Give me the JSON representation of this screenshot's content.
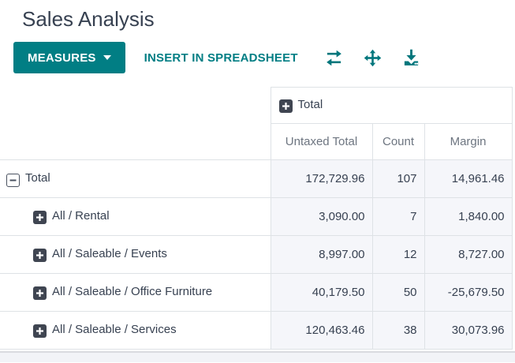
{
  "page": {
    "title": "Sales Analysis"
  },
  "toolbar": {
    "measures_label": "MEASURES",
    "insert_label": "INSERT IN SPREADSHEET",
    "icons": {
      "flip": "flip-axis-icon",
      "expand": "expand-all-icon",
      "download": "download-icon"
    }
  },
  "pivot": {
    "col_group_header": "Total",
    "measure_headers": [
      "Untaxed Total",
      "Count",
      "Margin"
    ],
    "rows": [
      {
        "label": "Total",
        "expanded": true,
        "level": 0,
        "values": [
          "172,729.96",
          "107",
          "14,961.46"
        ]
      },
      {
        "label": "All / Rental",
        "expanded": false,
        "level": 1,
        "values": [
          "3,090.00",
          "7",
          "1,840.00"
        ]
      },
      {
        "label": "All / Saleable / Events",
        "expanded": false,
        "level": 1,
        "values": [
          "8,997.00",
          "12",
          "8,727.00"
        ]
      },
      {
        "label": "All / Saleable / Office Furniture",
        "expanded": false,
        "level": 1,
        "values": [
          "40,179.50",
          "50",
          "-25,679.50"
        ]
      },
      {
        "label": "All / Saleable / Services",
        "expanded": false,
        "level": 1,
        "values": [
          "120,463.46",
          "38",
          "30,073.96"
        ]
      }
    ]
  },
  "colors": {
    "accent": "#017e84",
    "text_dark": "#374151",
    "text_muted": "#6d7580",
    "border": "#dee2e6",
    "value_cell_bg": "#f5f6fa",
    "expand_icon_bg": "#3f4551"
  }
}
